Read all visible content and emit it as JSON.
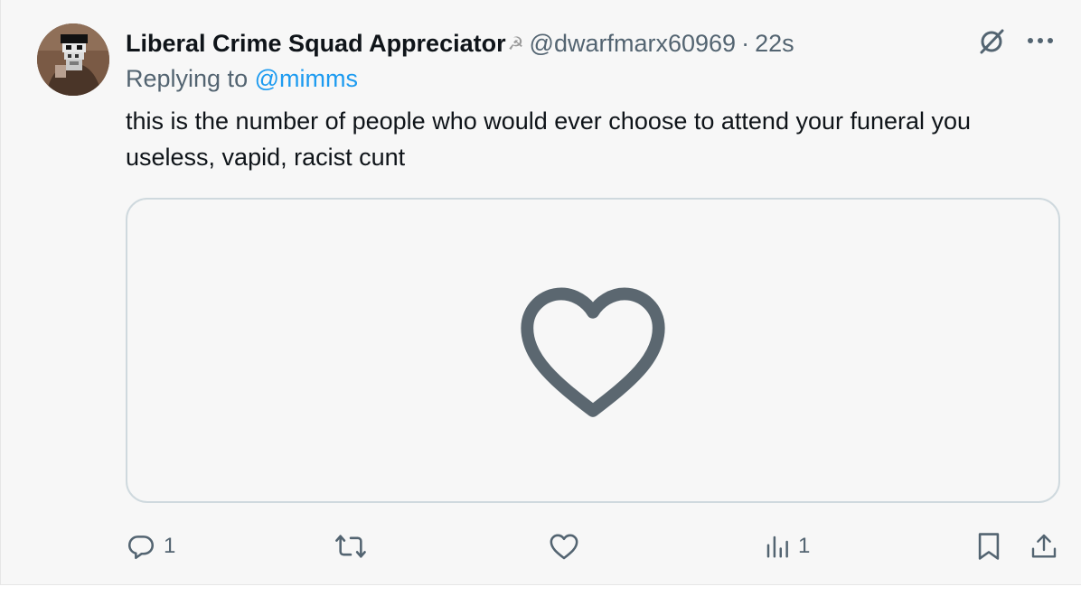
{
  "tweet": {
    "display_name": "Liberal Crime Squad Appreciator",
    "name_emoji": "☭",
    "handle": "@dwarfmarx60969",
    "separator": "·",
    "timestamp": "22s",
    "reply_prefix": "Replying to",
    "reply_handle": "@mimms",
    "text": "this is the number of people who would ever choose to attend your funeral you useless, vapid, racist cunt"
  },
  "media": {
    "icon": "heart-icon"
  },
  "actions": {
    "reply_count": "1",
    "retweet_count": "",
    "like_count": "",
    "views_count": "1"
  },
  "icons": {
    "grok": "grok-icon",
    "more": "more-icon",
    "reply": "reply-icon",
    "retweet": "retweet-icon",
    "like": "heart-icon",
    "views": "views-icon",
    "bookmark": "bookmark-icon",
    "share": "share-icon"
  },
  "colors": {
    "background": "#f7f7f7",
    "text": "#0f1419",
    "muted": "#536471",
    "link": "#1d9bf0",
    "border": "#cfd9de",
    "media_heart": "#5b6770"
  }
}
